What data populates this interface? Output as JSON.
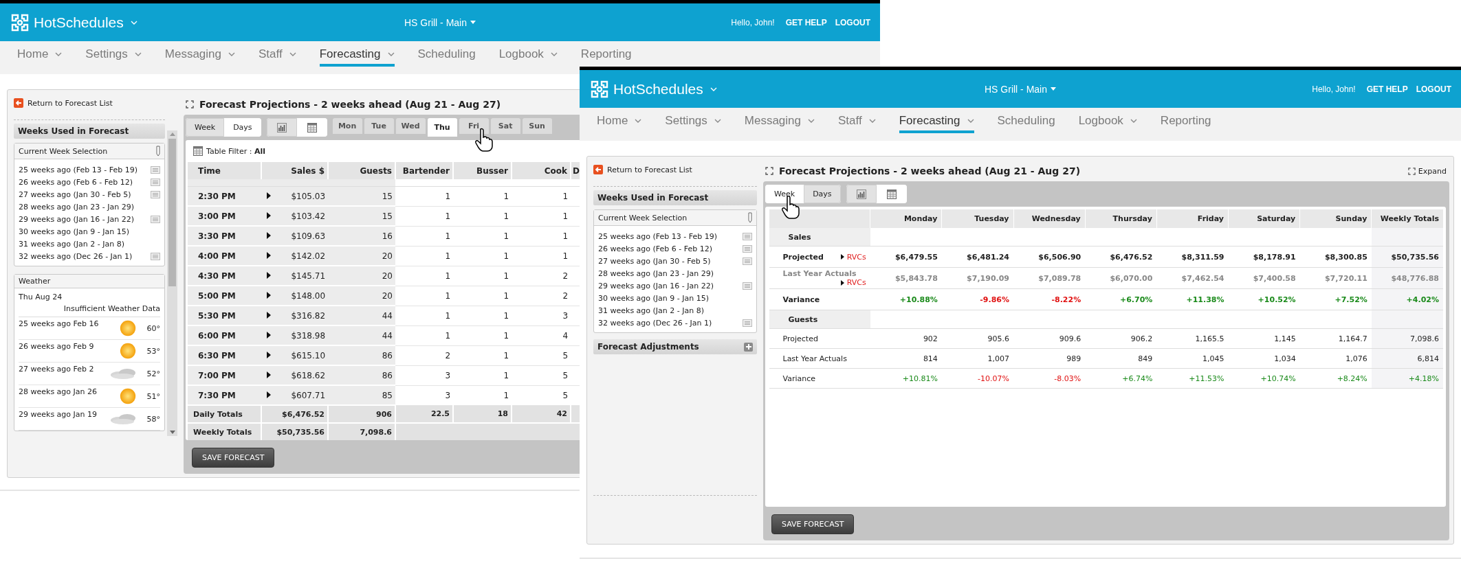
{
  "windows": [
    {
      "header": {
        "brand": "HotSchedules",
        "location": "HS Grill - Main",
        "greeting": "Hello, John!",
        "links": [
          "GET HELP",
          "LOGOUT"
        ]
      },
      "nav": [
        {
          "label": "Home",
          "menu": true,
          "selected": false
        },
        {
          "label": "Settings",
          "menu": true,
          "selected": false
        },
        {
          "label": "Messaging",
          "menu": true,
          "selected": false
        },
        {
          "label": "Staff",
          "menu": true,
          "selected": false
        },
        {
          "label": "Forecasting",
          "menu": true,
          "selected": true
        },
        {
          "label": "Scheduling",
          "menu": false,
          "selected": false
        },
        {
          "label": "Logbook",
          "menu": true,
          "selected": false
        },
        {
          "label": "Reporting",
          "menu": false,
          "selected": false
        }
      ],
      "sidebar": {
        "return_link": "Return to Forecast List",
        "scrollable": true,
        "weeks_title": "Weeks Used in Forecast",
        "selection_title": "Current Week Selection",
        "weeks": [
          {
            "label": "25 weeks ago (Feb 13 - Feb 19)",
            "notes": true
          },
          {
            "label": "26 weeks ago (Feb 6 - Feb 12)",
            "notes": true
          },
          {
            "label": "27 weeks ago (Jan 30 - Feb 5)",
            "notes": true
          },
          {
            "label": "28 weeks ago (Jan 23 - Jan 29)",
            "notes": false
          },
          {
            "label": "29 weeks ago (Jan 16 - Jan 22)",
            "notes": true
          },
          {
            "label": "30 weeks ago (Jan 9 - Jan 15)",
            "notes": false
          },
          {
            "label": "31 weeks ago (Jan 2 - Jan 8)",
            "notes": false
          },
          {
            "label": "32 weeks ago (Dec 26 - Jan 1)",
            "notes": true
          }
        ],
        "weather": {
          "title": "Weather",
          "date": "Thu Aug 24",
          "message": "Insufficient Weather Data",
          "rows": [
            {
              "label": "25 weeks ago Feb 16",
              "kind": "sunny",
              "temperature": "60°"
            },
            {
              "label": "26 weeks ago Feb 9",
              "kind": "sunny",
              "temperature": "53°"
            },
            {
              "label": "27 weeks ago Feb 2",
              "kind": "cloudy",
              "temperature": "52°"
            },
            {
              "label": "28 weeks ago Jan 26",
              "kind": "sunny",
              "temperature": "51°"
            },
            {
              "label": "29 weeks ago Jan 19",
              "kind": "cloudy",
              "temperature": "58°"
            }
          ]
        }
      },
      "main": {
        "title": "Forecast Projections - 2 weeks ahead (Aug 21 - Aug 27)",
        "view_tabs": [
          {
            "label": "Week",
            "selected": false,
            "hovered": false
          },
          {
            "label": "Days",
            "selected": true,
            "hovered": false
          }
        ],
        "display_toggle": [
          {
            "kind": "chart",
            "selected": false
          },
          {
            "kind": "table",
            "selected": true
          }
        ],
        "day_tabs": [
          {
            "label": "Mon",
            "selected": false,
            "hovered": false
          },
          {
            "label": "Tue",
            "selected": false,
            "hovered": false
          },
          {
            "label": "Wed",
            "selected": false,
            "hovered": false
          },
          {
            "label": "Thu",
            "selected": true,
            "hovered": false
          },
          {
            "label": "Fri",
            "selected": false,
            "hovered": true
          },
          {
            "label": "Sat",
            "selected": false,
            "hovered": false
          },
          {
            "label": "Sun",
            "selected": false,
            "hovered": false
          }
        ],
        "table_filter": "Table Filter : **All**",
        "day_table": {
          "columns": [
            "Time",
            "Sales $",
            "Guests",
            "Bartender",
            "Busser",
            "Cook",
            "D"
          ],
          "rows": [
            {
              "time": "2:30 PM",
              "sales": "$105.03",
              "guests": "15",
              "staff": [
                "1",
                "1",
                "1"
              ]
            },
            {
              "time": "3:00 PM",
              "sales": "$103.42",
              "guests": "15",
              "staff": [
                "1",
                "1",
                "1"
              ]
            },
            {
              "time": "3:30 PM",
              "sales": "$109.63",
              "guests": "16",
              "staff": [
                "1",
                "1",
                "1"
              ]
            },
            {
              "time": "4:00 PM",
              "sales": "$142.02",
              "guests": "20",
              "staff": [
                "1",
                "1",
                "1"
              ]
            },
            {
              "time": "4:30 PM",
              "sales": "$145.71",
              "guests": "20",
              "staff": [
                "1",
                "1",
                "2"
              ]
            },
            {
              "time": "5:00 PM",
              "sales": "$148.00",
              "guests": "20",
              "staff": [
                "1",
                "1",
                "2"
              ]
            },
            {
              "time": "5:30 PM",
              "sales": "$316.82",
              "guests": "44",
              "staff": [
                "1",
                "1",
                "3"
              ]
            },
            {
              "time": "6:00 PM",
              "sales": "$318.98",
              "guests": "44",
              "staff": [
                "1",
                "1",
                "4"
              ]
            },
            {
              "time": "6:30 PM",
              "sales": "$615.10",
              "guests": "86",
              "staff": [
                "2",
                "1",
                "5"
              ]
            },
            {
              "time": "7:00 PM",
              "sales": "$618.62",
              "guests": "86",
              "staff": [
                "3",
                "1",
                "5"
              ]
            },
            {
              "time": "7:30 PM",
              "sales": "$607.71",
              "guests": "85",
              "staff": [
                "3",
                "1",
                "5"
              ]
            }
          ],
          "totals": [
            {
              "label": "Daily Totals",
              "values": [
                "$6,476.52",
                "906",
                "22.5",
                "18",
                "42"
              ]
            },
            {
              "label": "Weekly Totals",
              "values": [
                "$50,735.56",
                "7,098.6"
              ]
            }
          ]
        },
        "save_button": "SAVE FORECAST"
      }
    },
    {
      "header": {
        "brand": "HotSchedules",
        "location": "HS Grill - Main",
        "greeting": "Hello, John!",
        "links": [
          "GET HELP",
          "LOGOUT"
        ]
      },
      "nav": [
        {
          "label": "Home",
          "menu": true,
          "selected": false
        },
        {
          "label": "Settings",
          "menu": true,
          "selected": false
        },
        {
          "label": "Messaging",
          "menu": true,
          "selected": false
        },
        {
          "label": "Staff",
          "menu": true,
          "selected": false
        },
        {
          "label": "Forecasting",
          "menu": true,
          "selected": true
        },
        {
          "label": "Scheduling",
          "menu": false,
          "selected": false
        },
        {
          "label": "Logbook",
          "menu": true,
          "selected": false
        },
        {
          "label": "Reporting",
          "menu": false,
          "selected": false
        }
      ],
      "sidebar": {
        "return_link": "Return to Forecast List",
        "scrollable": false,
        "weeks_title": "Weeks Used in Forecast",
        "selection_title": "Current Week Selection",
        "weeks": [
          {
            "label": "25 weeks ago (Feb 13 - Feb 19)",
            "notes": true
          },
          {
            "label": "26 weeks ago (Feb 6 - Feb 12)",
            "notes": true
          },
          {
            "label": "27 weeks ago (Jan 30 - Feb 5)",
            "notes": true
          },
          {
            "label": "28 weeks ago (Jan 23 - Jan 29)",
            "notes": false
          },
          {
            "label": "29 weeks ago (Jan 16 - Jan 22)",
            "notes": true
          },
          {
            "label": "30 weeks ago (Jan 9 - Jan 15)",
            "notes": false
          },
          {
            "label": "31 weeks ago (Jan 2 - Jan 8)",
            "notes": false
          },
          {
            "label": "32 weeks ago (Dec 26 - Jan 1)",
            "notes": true
          }
        ],
        "adjustments_title": "Forecast Adjustments"
      },
      "main": {
        "title": "Forecast Projections - 2 weeks ahead (Aug 21 - Aug 27)",
        "expand": "Expand",
        "view_tabs": [
          {
            "label": "Week",
            "selected": true,
            "hovered": true
          },
          {
            "label": "Days",
            "selected": false,
            "hovered": false
          }
        ],
        "display_toggle": [
          {
            "kind": "chart",
            "selected": false
          },
          {
            "kind": "table",
            "selected": true
          }
        ],
        "week_table": {
          "columns": [
            "Monday",
            "Tuesday",
            "Wednesday",
            "Thursday",
            "Friday",
            "Saturday",
            "Sunday",
            "Weekly Totals"
          ],
          "sections": [
            {
              "title": "Sales",
              "emphasized": true,
              "rows": [
                {
                  "kind": "projected",
                  "label": "Projected",
                  "link": "RVCs",
                  "values": [
                    "$6,479.55",
                    "$6,481.24",
                    "$6,506.90",
                    "$6,476.52",
                    "$8,311.59",
                    "$8,178.91",
                    "$8,300.85",
                    "$50,735.56"
                  ]
                },
                {
                  "kind": "actuals",
                  "label": "Last Year Actuals",
                  "link": "RVCs",
                  "values": [
                    "$5,843.78",
                    "$7,190.09",
                    "$7,089.78",
                    "$6,070.00",
                    "$7,462.54",
                    "$7,400.58",
                    "$7,720.11",
                    "$48,776.88"
                  ]
                },
                {
                  "kind": "variance",
                  "label": "Variance",
                  "values": [
                    {
                      "text": "+10.88%",
                      "negative": false
                    },
                    {
                      "text": "-9.86%",
                      "negative": true
                    },
                    {
                      "text": "-8.22%",
                      "negative": true
                    },
                    {
                      "text": "+6.70%",
                      "negative": false
                    },
                    {
                      "text": "+11.38%",
                      "negative": false
                    },
                    {
                      "text": "+10.52%",
                      "negative": false
                    },
                    {
                      "text": "+7.52%",
                      "negative": false
                    },
                    {
                      "text": "+4.02%",
                      "negative": false
                    }
                  ]
                }
              ]
            },
            {
              "title": "Guests",
              "emphasized": false,
              "rows": [
                {
                  "kind": "projected",
                  "label": "Projected",
                  "values": [
                    "902",
                    "905.6",
                    "909.6",
                    "906.2",
                    "1,165.5",
                    "1,145",
                    "1,164.7",
                    "7,098.6"
                  ]
                },
                {
                  "kind": "actuals",
                  "label": "Last Year Actuals",
                  "values": [
                    "814",
                    "1,007",
                    "989",
                    "849",
                    "1,045",
                    "1,034",
                    "1,076",
                    "6,814"
                  ]
                },
                {
                  "kind": "variance",
                  "label": "Variance",
                  "values": [
                    {
                      "text": "+10.81%",
                      "negative": false
                    },
                    {
                      "text": "-10.07%",
                      "negative": true
                    },
                    {
                      "text": "-8.03%",
                      "negative": true
                    },
                    {
                      "text": "+6.74%",
                      "negative": false
                    },
                    {
                      "text": "+11.53%",
                      "negative": false
                    },
                    {
                      "text": "+10.74%",
                      "negative": false
                    },
                    {
                      "text": "+8.24%",
                      "negative": false
                    },
                    {
                      "text": "+4.18%",
                      "negative": false
                    }
                  ]
                }
              ]
            }
          ]
        },
        "save_button": "SAVE FORECAST"
      }
    }
  ]
}
